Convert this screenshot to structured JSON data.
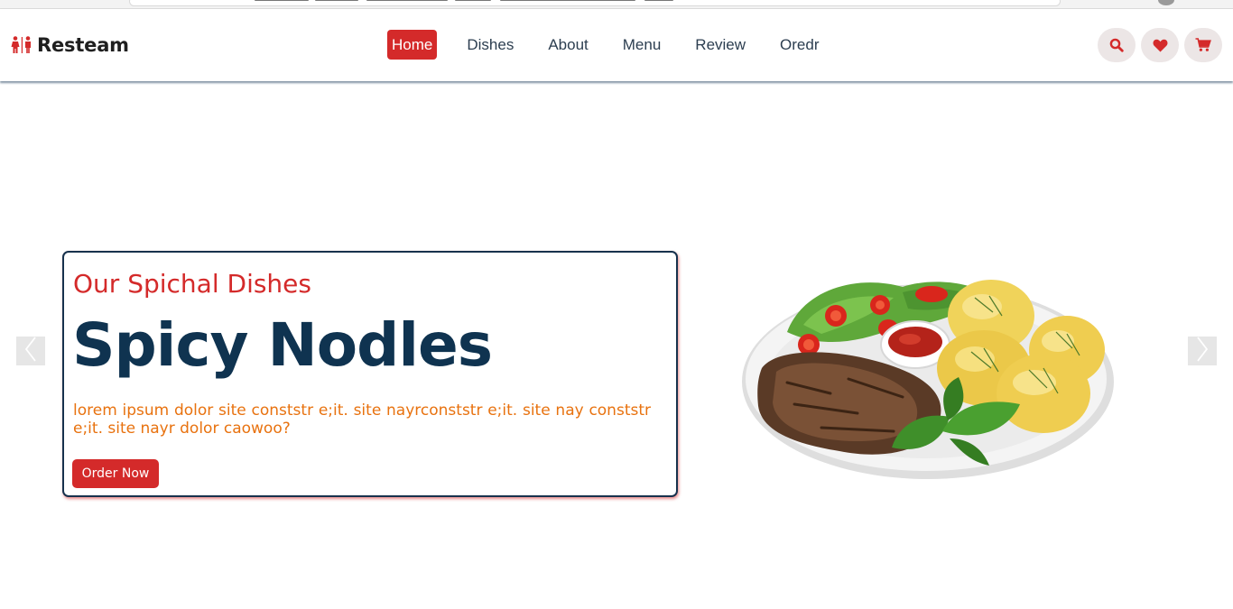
{
  "brand": {
    "name": "Resteam",
    "accent": "#d42a2a",
    "dark": "#0f3350"
  },
  "nav": {
    "items": [
      {
        "label": "Home",
        "active": true
      },
      {
        "label": "Dishes",
        "active": false
      },
      {
        "label": "About",
        "active": false
      },
      {
        "label": "Menu",
        "active": false
      },
      {
        "label": "Review",
        "active": false
      },
      {
        "label": "Oredr",
        "active": false
      }
    ]
  },
  "header_icons": [
    "search-icon",
    "heart-icon",
    "cart-icon"
  ],
  "hero": {
    "subtitle": "Our Spichal Dishes",
    "title": "Spicy Nodles",
    "description": "lorem ipsum dolor site conststr e;it. site nayrconststr e;it. site nay conststr e;it. site nayr dolor caowoo?",
    "cta_label": "Order Now",
    "subtitle_color": "#d42a2a",
    "description_color": "#e8720f"
  },
  "slider": {
    "prev_icon": "chevron-left-icon",
    "next_icon": "chevron-right-icon"
  }
}
